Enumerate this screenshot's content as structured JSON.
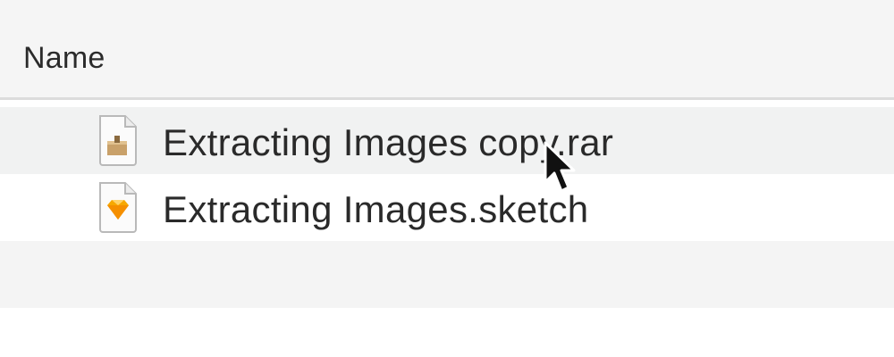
{
  "window": {
    "column_header": "Name"
  },
  "files": [
    {
      "name": "Extracting Images copy.rar",
      "icon": "rar-archive-icon"
    },
    {
      "name": "Extracting Images.sketch",
      "icon": "sketch-file-icon"
    }
  ],
  "colors": {
    "header_bg": "#f5f5f5",
    "row_alt_bg": "#f4f4f4",
    "row_bg": "#ffffff",
    "text": "#2a2a2a",
    "sketch_diamond": "#f7a800"
  }
}
